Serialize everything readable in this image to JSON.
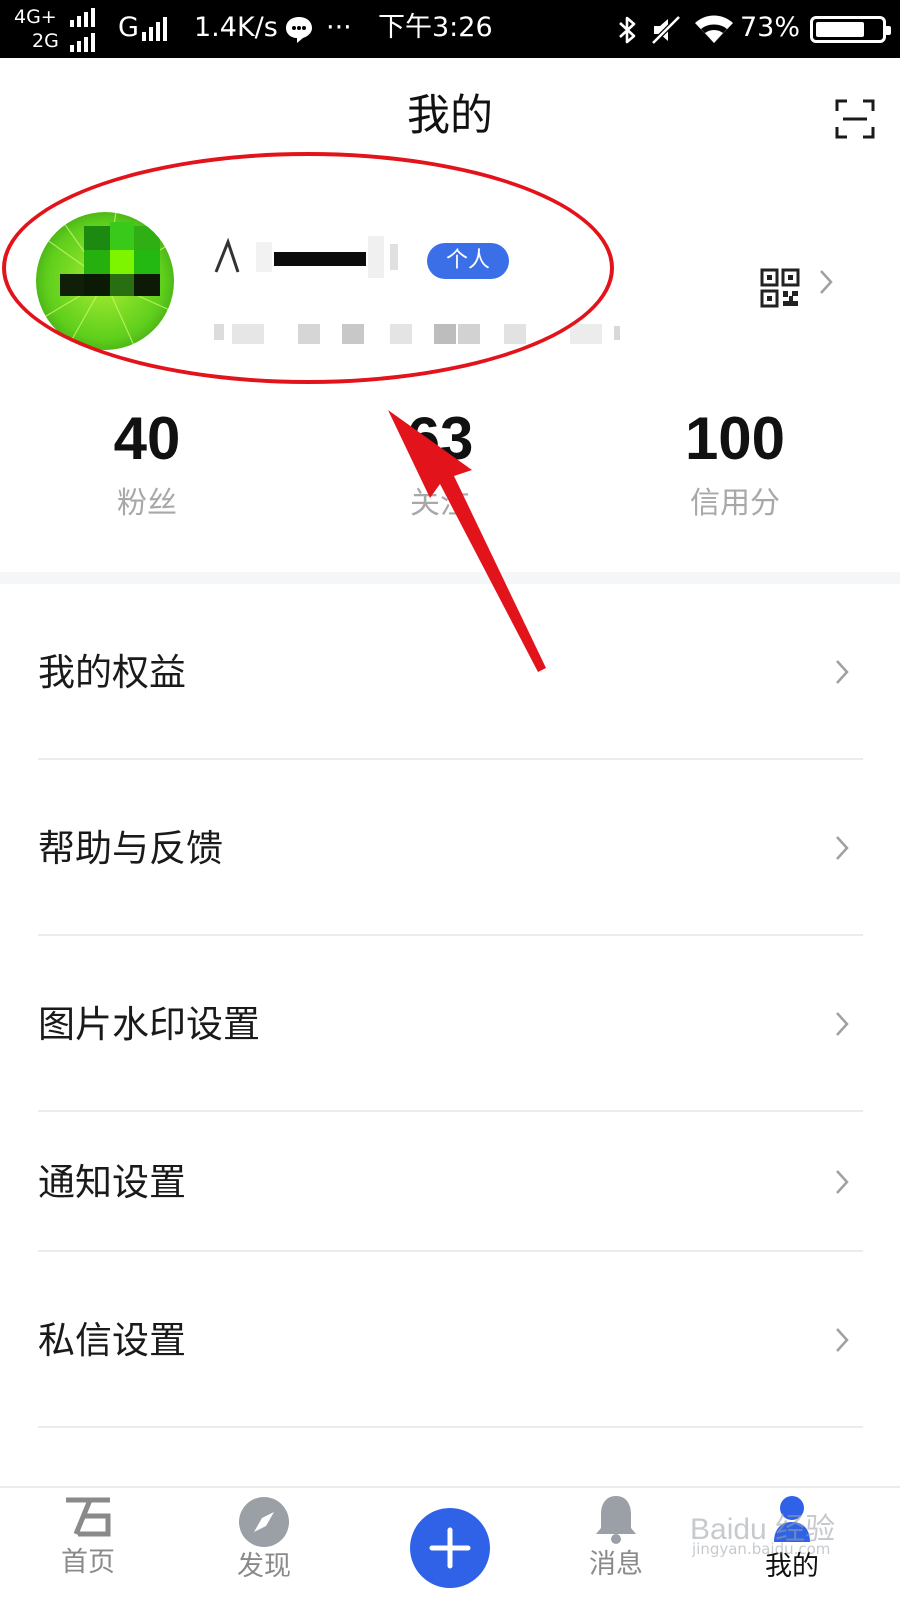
{
  "status_bar": {
    "network_top": "4G+",
    "network_bottom": "2G",
    "network_g": "G",
    "speed": "1.4K/s",
    "more": "···",
    "time": "下午3:26",
    "battery": "73%",
    "battery_level": 0.73
  },
  "header": {
    "title": "我的",
    "scan_icon": "scan-frame-icon"
  },
  "profile": {
    "badge": "个人",
    "qr_icon": "qr-code-icon",
    "avatar_color": "#3fbf1a"
  },
  "stats": [
    {
      "value": "40",
      "label": "粉丝"
    },
    {
      "value": "63",
      "label": "关注"
    },
    {
      "value": "100",
      "label": "信用分"
    }
  ],
  "menu": [
    {
      "label": "我的权益"
    },
    {
      "label": "帮助与反馈"
    },
    {
      "label": "图片水印设置"
    },
    {
      "label": "通知设置"
    },
    {
      "label": "私信设置"
    }
  ],
  "tabs": [
    {
      "label": "首页",
      "icon": "home-icon"
    },
    {
      "label": "发现",
      "icon": "compass-icon"
    },
    {
      "label": "",
      "icon": "plus-icon"
    },
    {
      "label": "消息",
      "icon": "bell-icon"
    },
    {
      "label": "我的",
      "icon": "user-icon"
    }
  ],
  "watermark": {
    "brand": "Baidu 经验",
    "url": "jingyan.baidu.com"
  },
  "colors": {
    "accent": "#2f62e6",
    "badge": "#3b6fe8",
    "annotation": "#e3131b",
    "muted_text": "#a8a8a8"
  }
}
